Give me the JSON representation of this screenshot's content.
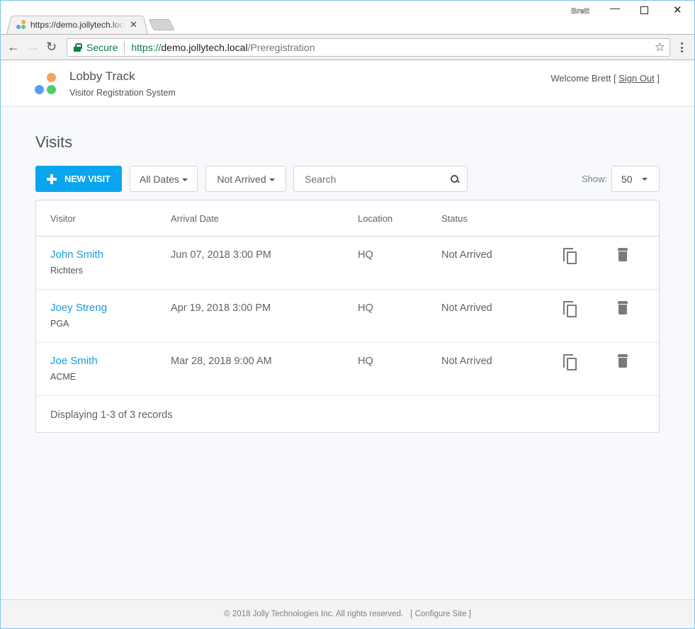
{
  "browser": {
    "tab_title": "https://demo.jollytech.local/Preregistration",
    "profile_name": "Brett",
    "secure_label": "Secure",
    "url_scheme": "https://",
    "url_host": "demo.jollytech.local",
    "url_path": "/Preregistration",
    "icons": {
      "back": "←",
      "forward": "→",
      "reload": "↻",
      "star": "☆",
      "tab_close": "✕",
      "minimize": "—",
      "close": "✕"
    }
  },
  "header": {
    "brand_title": "Lobby Track",
    "brand_subtitle": "Visitor Registration System",
    "welcome_prefix": "Welcome Brett [ ",
    "sign_out_label": "Sign Out",
    "welcome_suffix": " ]",
    "logo_colors": {
      "orange": "#f5a55a",
      "blue": "#5b9cf0",
      "green": "#4fcd6d"
    }
  },
  "main": {
    "title": "Visits",
    "new_visit_label": "NEW VISIT",
    "date_filter": "All Dates",
    "status_filter": "Not Arrived",
    "search_placeholder": "Search",
    "show_label": "Show:",
    "page_size": "50",
    "accent_color": "#0aa5ee"
  },
  "table": {
    "columns": [
      "Visitor",
      "Arrival Date",
      "Location",
      "Status"
    ],
    "rows": [
      {
        "name": "John Smith",
        "company": "Richters",
        "arrival": "Jun 07, 2018 3:00 PM",
        "location": "HQ",
        "status": "Not Arrived"
      },
      {
        "name": "Joey Streng",
        "company": "PGA",
        "arrival": "Apr 19, 2018 3:00 PM",
        "location": "HQ",
        "status": "Not Arrived"
      },
      {
        "name": "Joe Smith",
        "company": "ACME",
        "arrival": "Mar 28, 2018 9:00 AM",
        "location": "HQ",
        "status": "Not Arrived"
      }
    ],
    "summary": "Displaying 1-3 of 3 records"
  },
  "footer": {
    "copyright": "© 2018 Jolly Technologies Inc. All rights reserved.",
    "configure_label": "[ Configure Site ]"
  }
}
